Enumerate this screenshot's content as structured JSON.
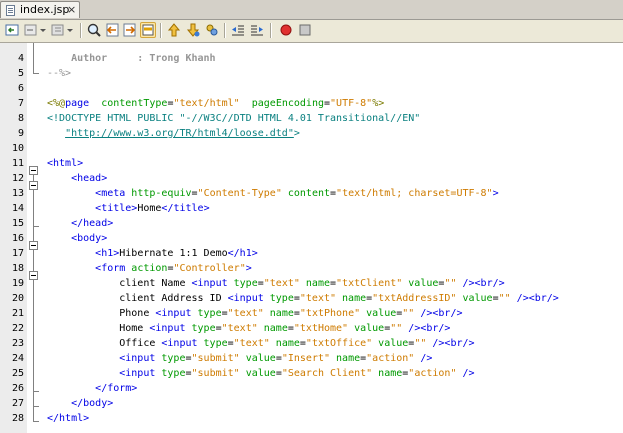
{
  "tab": {
    "label": "index.jsp",
    "close": "×"
  },
  "toolbar": {
    "buttons": [
      "back-history",
      "forward-history",
      "last-edit",
      "find-selection",
      "find-previous",
      "find-next",
      "toggle-highlight",
      "shift-line-left-bookmark",
      "previous-bookmark",
      "next-bookmark",
      "toggle-bookmark",
      "shift-left",
      "shift-right",
      "start-macro",
      "stop-macro"
    ]
  },
  "editor": {
    "lines": [
      {
        "n": "4"
      },
      {
        "n": "5"
      },
      {
        "n": "6"
      },
      {
        "n": "7"
      },
      {
        "n": "8"
      },
      {
        "n": "9"
      },
      {
        "n": "10"
      },
      {
        "n": "11"
      },
      {
        "n": "12"
      },
      {
        "n": "13"
      },
      {
        "n": "14"
      },
      {
        "n": "15"
      },
      {
        "n": "16"
      },
      {
        "n": "17"
      },
      {
        "n": "18"
      },
      {
        "n": "19"
      },
      {
        "n": "20"
      },
      {
        "n": "21"
      },
      {
        "n": "22"
      },
      {
        "n": "23"
      },
      {
        "n": "24"
      },
      {
        "n": "25"
      },
      {
        "n": "26"
      },
      {
        "n": "27"
      },
      {
        "n": "28"
      }
    ],
    "tokens": [
      [
        [
          "cmtbold",
          "    Author     : Trong Khanh"
        ]
      ],
      [
        [
          "cmt",
          "--%>"
        ]
      ],
      [],
      [
        [
          "dir",
          "<%@"
        ],
        [
          "tag",
          "page"
        ],
        [
          "",
          "  "
        ],
        [
          "attr",
          "contentType"
        ],
        [
          "",
          "="
        ],
        [
          "val",
          "\"text/html\""
        ],
        [
          "",
          "  "
        ],
        [
          "attr",
          "pageEncoding"
        ],
        [
          "",
          "="
        ],
        [
          "val",
          "\"UTF-8\""
        ],
        [
          "dir",
          "%>"
        ]
      ],
      [
        [
          "dt",
          "<!DOCTYPE HTML PUBLIC \"-//W3C//DTD HTML 4.01 Transitional//EN\""
        ]
      ],
      [
        [
          "",
          "   "
        ],
        [
          "url",
          "\"http://www.w3.org/TR/html4/loose.dtd\""
        ],
        [
          "dt",
          ">"
        ]
      ],
      [],
      [
        [
          "tag",
          "<html>"
        ]
      ],
      [
        [
          "",
          "    "
        ],
        [
          "tag",
          "<head>"
        ]
      ],
      [
        [
          "",
          "        "
        ],
        [
          "tag",
          "<meta"
        ],
        [
          "",
          ""
        ],
        [
          "attr",
          " http-equiv"
        ],
        [
          "",
          "="
        ],
        [
          "val",
          "\"Content-Type\""
        ],
        [
          "attr",
          " content"
        ],
        [
          "",
          "="
        ],
        [
          "val",
          "\"text/html; charset=UTF-8\""
        ],
        [
          "tag",
          ">"
        ]
      ],
      [
        [
          "",
          "        "
        ],
        [
          "tag",
          "<title>"
        ],
        [
          "",
          "Home"
        ],
        [
          "tag",
          "</title>"
        ]
      ],
      [
        [
          "",
          "    "
        ],
        [
          "tag",
          "</head>"
        ]
      ],
      [
        [
          "",
          "    "
        ],
        [
          "tag",
          "<body>"
        ]
      ],
      [
        [
          "",
          "        "
        ],
        [
          "tag",
          "<h1>"
        ],
        [
          "",
          "Hibernate 1:1 Demo"
        ],
        [
          "tag",
          "</h1>"
        ]
      ],
      [
        [
          "",
          "        "
        ],
        [
          "tag",
          "<form"
        ],
        [
          "attr",
          " action"
        ],
        [
          "",
          "="
        ],
        [
          "val",
          "\"Controller\""
        ],
        [
          "tag",
          ">"
        ]
      ],
      [
        [
          "",
          "            client Name "
        ],
        [
          "tag",
          "<input"
        ],
        [
          "attr",
          " type"
        ],
        [
          "",
          "="
        ],
        [
          "val",
          "\"text\""
        ],
        [
          "attr",
          " name"
        ],
        [
          "",
          "="
        ],
        [
          "val",
          "\"txtClient\""
        ],
        [
          "attr",
          " value"
        ],
        [
          "",
          "="
        ],
        [
          "val",
          "\"\""
        ],
        [
          "tag",
          " /><br/>"
        ]
      ],
      [
        [
          "",
          "            client Address ID "
        ],
        [
          "tag",
          "<input"
        ],
        [
          "attr",
          " type"
        ],
        [
          "",
          "="
        ],
        [
          "val",
          "\"text\""
        ],
        [
          "attr",
          " name"
        ],
        [
          "",
          "="
        ],
        [
          "val",
          "\"txtAddressID\""
        ],
        [
          "attr",
          " value"
        ],
        [
          "",
          "="
        ],
        [
          "val",
          "\"\""
        ],
        [
          "tag",
          " /><br/>"
        ]
      ],
      [
        [
          "",
          "            Phone "
        ],
        [
          "tag",
          "<input"
        ],
        [
          "attr",
          " type"
        ],
        [
          "",
          "="
        ],
        [
          "val",
          "\"text\""
        ],
        [
          "attr",
          " name"
        ],
        [
          "",
          "="
        ],
        [
          "val",
          "\"txtPhone\""
        ],
        [
          "attr",
          " value"
        ],
        [
          "",
          "="
        ],
        [
          "val",
          "\"\""
        ],
        [
          "tag",
          " /><br/>"
        ]
      ],
      [
        [
          "",
          "            Home "
        ],
        [
          "tag",
          "<input"
        ],
        [
          "attr",
          " type"
        ],
        [
          "",
          "="
        ],
        [
          "val",
          "\"text\""
        ],
        [
          "attr",
          " name"
        ],
        [
          "",
          "="
        ],
        [
          "val",
          "\"txtHome\""
        ],
        [
          "attr",
          " value"
        ],
        [
          "",
          "="
        ],
        [
          "val",
          "\"\""
        ],
        [
          "tag",
          " /><br/>"
        ]
      ],
      [
        [
          "",
          "            Office "
        ],
        [
          "tag",
          "<input"
        ],
        [
          "attr",
          " type"
        ],
        [
          "",
          "="
        ],
        [
          "val",
          "\"text\""
        ],
        [
          "attr",
          " name"
        ],
        [
          "",
          "="
        ],
        [
          "val",
          "\"txtOffice\""
        ],
        [
          "attr",
          " value"
        ],
        [
          "",
          "="
        ],
        [
          "val",
          "\"\""
        ],
        [
          "tag",
          " /><br/>"
        ]
      ],
      [
        [
          "",
          "            "
        ],
        [
          "tag",
          "<input"
        ],
        [
          "attr",
          " type"
        ],
        [
          "",
          "="
        ],
        [
          "val",
          "\"submit\""
        ],
        [
          "attr",
          " value"
        ],
        [
          "",
          "="
        ],
        [
          "val",
          "\"Insert\""
        ],
        [
          "attr",
          " name"
        ],
        [
          "",
          "="
        ],
        [
          "val",
          "\"action\""
        ],
        [
          "tag",
          " />"
        ]
      ],
      [
        [
          "",
          "            "
        ],
        [
          "tag",
          "<input"
        ],
        [
          "attr",
          " type"
        ],
        [
          "",
          "="
        ],
        [
          "val",
          "\"submit\""
        ],
        [
          "attr",
          " value"
        ],
        [
          "",
          "="
        ],
        [
          "val",
          "\"Search Client\""
        ],
        [
          "attr",
          " name"
        ],
        [
          "",
          "="
        ],
        [
          "val",
          "\"action\""
        ],
        [
          "tag",
          " />"
        ]
      ],
      [
        [
          "",
          "        "
        ],
        [
          "tag",
          "</form>"
        ]
      ],
      [
        [
          "",
          "    "
        ],
        [
          "tag",
          "</body>"
        ]
      ],
      [
        [
          "tag",
          "</html>"
        ]
      ]
    ]
  }
}
